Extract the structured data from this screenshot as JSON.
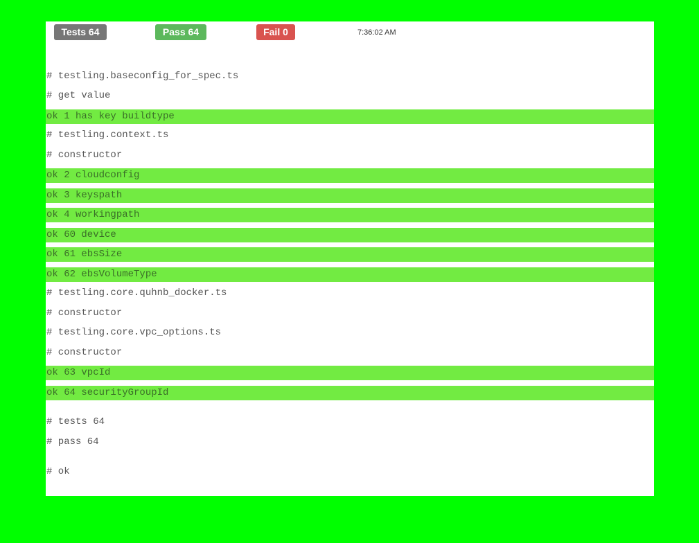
{
  "header": {
    "tests_badge": "Tests 64",
    "pass_badge": "Pass 64",
    "fail_badge": "Fail 0",
    "timestamp": "7:36:02 AM"
  },
  "colors": {
    "page_background": "#00ff00",
    "panel_background": "#ffffff",
    "ok_line_background": "#72eb42",
    "tests_badge": "#777777",
    "pass_badge": "#5cb85c",
    "fail_badge": "#d9534f"
  },
  "output": {
    "lines": [
      "# testling.baseconfig_for_spec.ts",
      "# get value",
      "ok 1 has key buildtype",
      "# testling.context.ts",
      "# constructor",
      "ok 2 cloudconfig",
      "ok 3 keyspath",
      "ok 4 workingpath",
      "ok 60 device",
      "ok 61 ebsSize",
      "ok 62 ebsVolumeType",
      "# testling.core.quhnb_docker.ts",
      "# constructor",
      "# testling.core.vpc_options.ts",
      "# constructor",
      "ok 63 vpcId",
      "ok 64 securityGroupId",
      "# tests 64",
      "# pass 64",
      "# ok"
    ]
  }
}
